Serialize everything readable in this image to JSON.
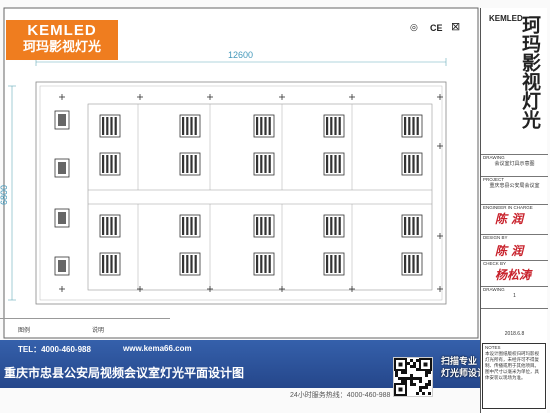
{
  "logo": {
    "en": "KEMLED",
    "cn": "珂玛影视灯光"
  },
  "cert_icons": {
    "ce": "CE",
    "round": "◎"
  },
  "dimensions": {
    "width": "12600",
    "height": "6800"
  },
  "legend": {
    "col1": "图例",
    "col2": "说明"
  },
  "contact": {
    "tel": "TEL：4000-460-988",
    "web": "www.kema66.com",
    "hotline": "24小时服务热线：4000-460-988"
  },
  "drawing_title": "重庆市忠县公安局视频会议室灯光平面设计图",
  "scan": {
    "line1": "扫描专业",
    "line2": "灯光师设计"
  },
  "title_block": {
    "brand": "珂玛影视灯光",
    "brand_en": "KEMLED",
    "drawing_label": "DRAWING",
    "drawing_value": "会议室灯具示意图",
    "project_label": "PROJECT",
    "project_value": "重庆忠县公安局会议室",
    "engineer_label": "ENGINEER IN CHARGE",
    "design_label": "DESIGN BY",
    "check_label": "CHECK BY",
    "drawing_no_label": "DRAWING",
    "drawing_no_value": "1",
    "date": "2018.6.8",
    "notes_label": "NOTES",
    "notes_text": "本设计图纸版权归珂玛影视灯光所有，未经许可不得复制、传播或用于其他项目。图中尺寸以毫米为单位，具体安装以现场为准。"
  }
}
